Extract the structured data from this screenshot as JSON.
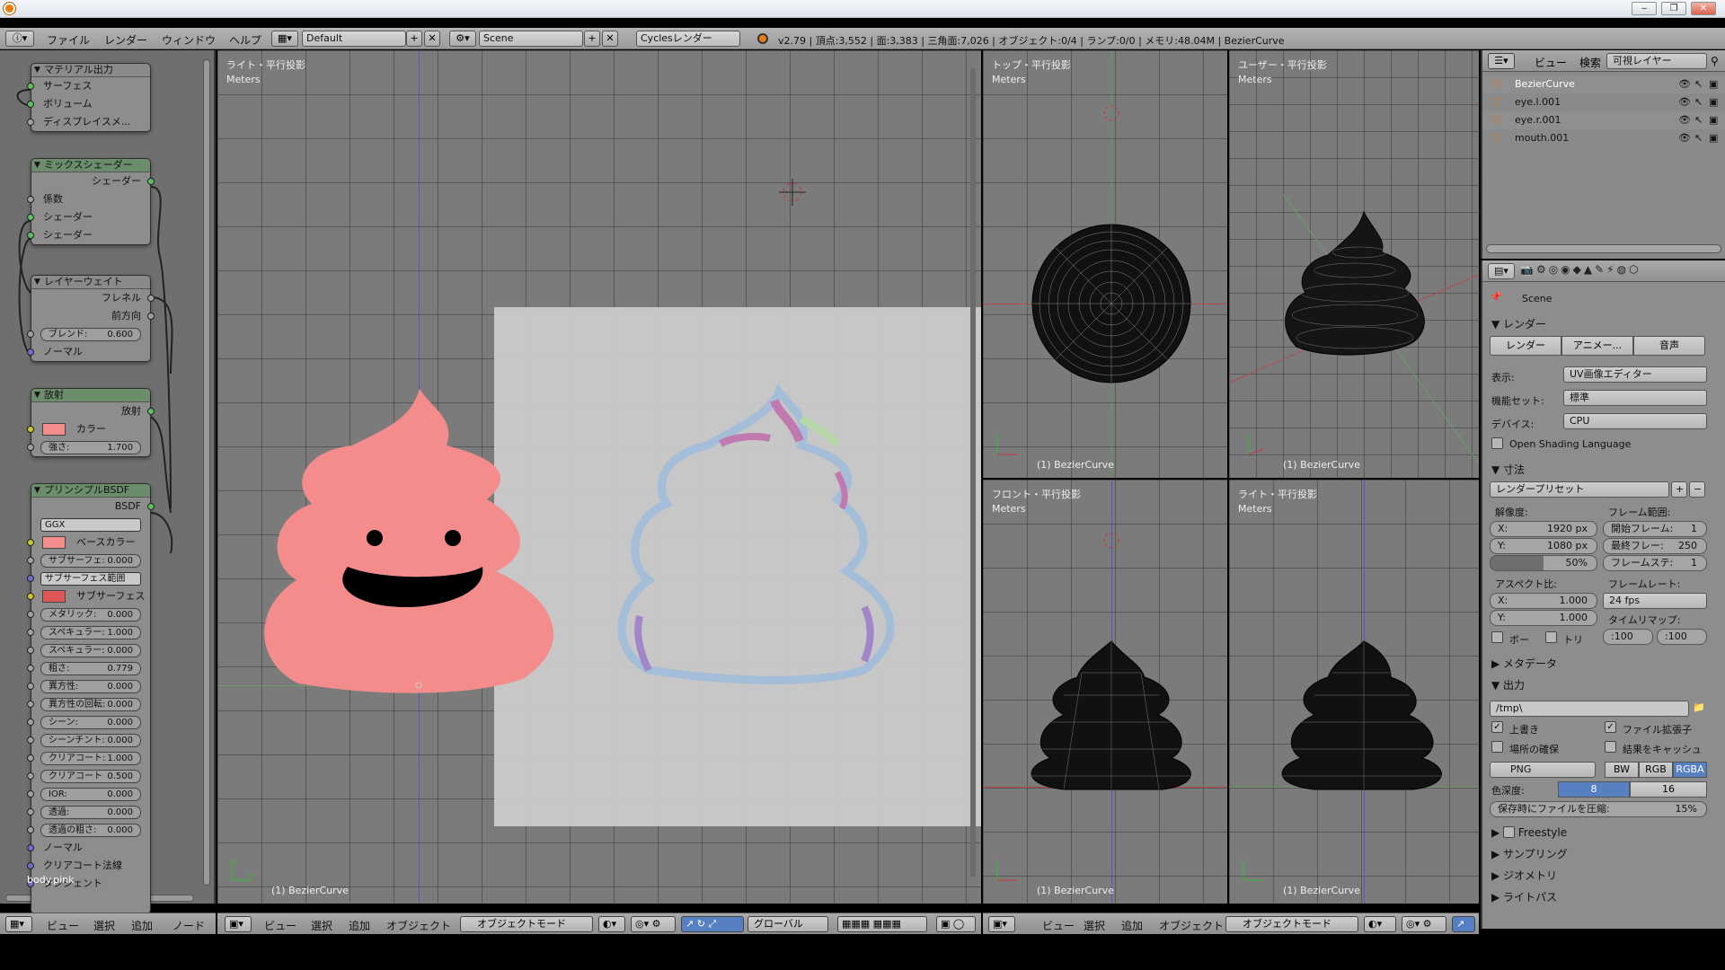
{
  "window": {
    "icon": "blender-logo-icon",
    "minimize": "▭",
    "restore": "▭",
    "close": "✕"
  },
  "info": {
    "menus": [
      "ファイル",
      "レンダー",
      "ウィンドウ",
      "ヘルプ"
    ],
    "layout": "Default",
    "scene": "Scene",
    "engine": "Cyclesレンダー",
    "stats": "v2.79 | 頂点:3,552 | 面:3,383 | 三角面:7,026 | オブジェクト:0/4 | ランプ:0/0 | メモリ:48.04M | BezierCurve"
  },
  "nodes": {
    "material_output": {
      "title": "マテリアル出力",
      "surface": "サーフェス",
      "volume": "ボリューム",
      "displacement": "ディスプレイスメ..."
    },
    "mix_shader": {
      "title": "ミックスシェーダー",
      "out": "シェーダー",
      "fac": "係数",
      "in1": "シェーダー",
      "in2": "シェーダー"
    },
    "layer_weight": {
      "title": "レイヤーウェイト",
      "fresnel": "フレネル",
      "facing": "前方向",
      "blend": "ブレンド:",
      "blend_val": "0.600",
      "normal": "ノーマル"
    },
    "emission": {
      "title": "放射",
      "out": "放射",
      "color": "カラー",
      "strength": "強さ:",
      "strength_val": "1.700"
    },
    "bsdf": {
      "title": "プリンシプルBSDF",
      "out": "BSDF",
      "dist": "GGX",
      "base": "ベースカラー",
      "subsurface": "サブサーフェ:",
      "subsurface_val": "0.000",
      "ss_radius": "サブサーフェス範囲",
      "ss_color": "サブサーフェス色",
      "params": [
        [
          "メタリック:",
          "0.000"
        ],
        [
          "スペキュラー:",
          "1.000"
        ],
        [
          "スペキュラー:",
          "0.000"
        ],
        [
          "粗さ:",
          "0.779"
        ],
        [
          "異方性:",
          "0.000"
        ],
        [
          "異方性の回転:",
          "0.000"
        ],
        [
          "シーン:",
          "0.000"
        ],
        [
          "シーンチント:",
          "0.000"
        ],
        [
          "クリアコート:",
          "1.000"
        ],
        [
          "クリアコート",
          "0.500"
        ],
        [
          "IOR:",
          "0.000"
        ],
        [
          "透過:",
          "0.000"
        ],
        [
          "透過の粗さ:",
          "0.000"
        ]
      ],
      "normal": "ノーマル",
      "cc_normal": "クリアコート法線",
      "tangent": "タンジェント"
    },
    "material_name": "body.pink"
  },
  "viewports": {
    "right": {
      "label": "ライト・平行投影",
      "units": "Meters",
      "obj": "(1) BezierCurve"
    },
    "top": {
      "label": "トップ・平行投影",
      "units": "Meters",
      "obj": "(1) BezierCurve"
    },
    "user": {
      "label": "ユーザー・平行投影",
      "units": "Meters",
      "obj": "(1) BezierCurve"
    },
    "front": {
      "label": "フロント・平行投影",
      "units": "Meters",
      "obj": "(1) BezierCurve"
    },
    "right2": {
      "label": "ライト・平行投影",
      "units": "Meters",
      "obj": "(1) BezierCurve"
    }
  },
  "bars": {
    "node": [
      "ビュー",
      "選択",
      "追加",
      "ノード"
    ],
    "view3d": [
      "ビュー",
      "選択",
      "追加",
      "オブジェクト"
    ],
    "mode": "オブジェクトモード",
    "orient": "グローバル",
    "view3d_2": [
      "ビュー",
      "選択",
      "追加",
      "オブジェクト"
    ]
  },
  "outliner": {
    "menus": [
      "ビュー",
      "検索"
    ],
    "filter": "可視レイヤー",
    "items": [
      "BezierCurve",
      "eye.l.001",
      "eye.r.001",
      "mouth.001"
    ]
  },
  "props": {
    "scene": "Scene",
    "render_section": "レンダー",
    "tabs": [
      "レンダー",
      "アニメー...",
      "音声"
    ],
    "display_label": "表示:",
    "display": "UV画像エディター",
    "featureset_label": "機能セット:",
    "featureset": "標準",
    "device_label": "デバイス:",
    "device": "CPU",
    "osl": "Open Shading Language",
    "dims_section": "寸法",
    "preset": "レンダープリセット",
    "res_label": "解像度:",
    "res_x_label": "X:",
    "res_x": "1920 px",
    "res_y_label": "Y:",
    "res_y": "1080 px",
    "res_pct": "50%",
    "frame_range": "フレーム範囲:",
    "start_label": "開始フレーム:",
    "start": "1",
    "end_label": "最終フレー:",
    "end": "250",
    "step_label": "フレームステ:",
    "step": "1",
    "aspect_label": "アスペクト比:",
    "ax_label": "X:",
    "ax": "1.000",
    "ay_label": "Y:",
    "ay": "1.000",
    "fps_label": "フレームレート:",
    "fps": "24 fps",
    "remap_label": "タイムリマップ:",
    "remap_old": ":100",
    "remap_new": ":100",
    "border": "ボー",
    "crop": "トリ",
    "meta_section": "メタデータ",
    "output_section": "出力",
    "path": "/tmp\\",
    "overwrite": "上書き",
    "ext": "ファイル拡張子",
    "placeholders": "場所の確保",
    "cache": "結果をキャッシュ",
    "format": "PNG",
    "bw": "BW",
    "rgb": "RGB",
    "rgba": "RGBA",
    "depth_label": "色深度:",
    "depth8": "8",
    "depth16": "16",
    "compress_label": "保存時にファイルを圧縮:",
    "compress": "15%",
    "freestyle": "Freestyle",
    "sampling": "サンプリング",
    "geometry": "ジオメトリ",
    "lightpaths": "ライトパス"
  },
  "colors": {
    "poo": "#f48c8c",
    "select": "#5680c2"
  }
}
